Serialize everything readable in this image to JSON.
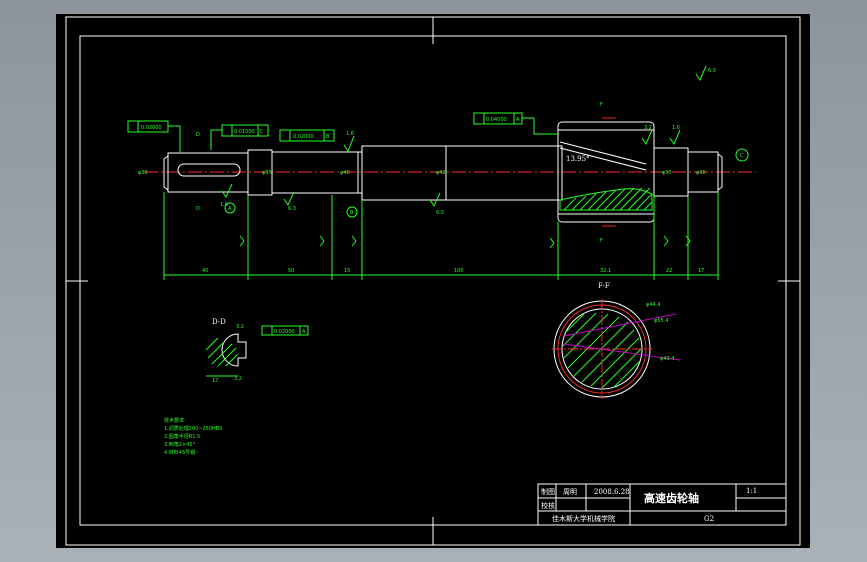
{
  "title_block": {
    "row1": [
      "制图",
      "周明",
      "2008.6.28"
    ],
    "row2": [
      "校核"
    ],
    "part_name": "高速齿轮轴",
    "scale": "1:1",
    "school": "佳木斯大学机械学院",
    "sheet": "G2"
  },
  "labels": {
    "section_dd": "D-D",
    "section_ff": "F-F",
    "ref_a": "A",
    "ref_b": "B",
    "ref_c": "C",
    "ref_d": "D",
    "ref_f": "F"
  },
  "dimensions": {
    "bottom": [
      "40",
      "50",
      "15",
      "100",
      "32.1",
      "22",
      "17"
    ],
    "keyway_width": "17",
    "key_depth": "3.2",
    "diam_outer": "φ44.4",
    "diam_tip": "φ55.4",
    "diam_root": "φ49.4",
    "helix_angle": "13.95°",
    "roughness_a": "1.6",
    "roughness_b": "6.3",
    "roughness_c": "3.2",
    "roughness_d": "0.8",
    "roughness_general": "6.3"
  },
  "tolerances": {
    "t1": "0.02000",
    "t2": "0.01500",
    "t3": "0.02000",
    "t4": "0.04000",
    "t5": "0.02000",
    "datum_c": "C",
    "datum_b": "B",
    "datum_a": "A"
  },
  "tech_notes": {
    "heading": "技术要求",
    "lines": [
      "1.调质处理200~250HBS",
      "2.圆角半径R1.5",
      "3.倒角2×45°",
      "4.材料45号钢"
    ]
  }
}
